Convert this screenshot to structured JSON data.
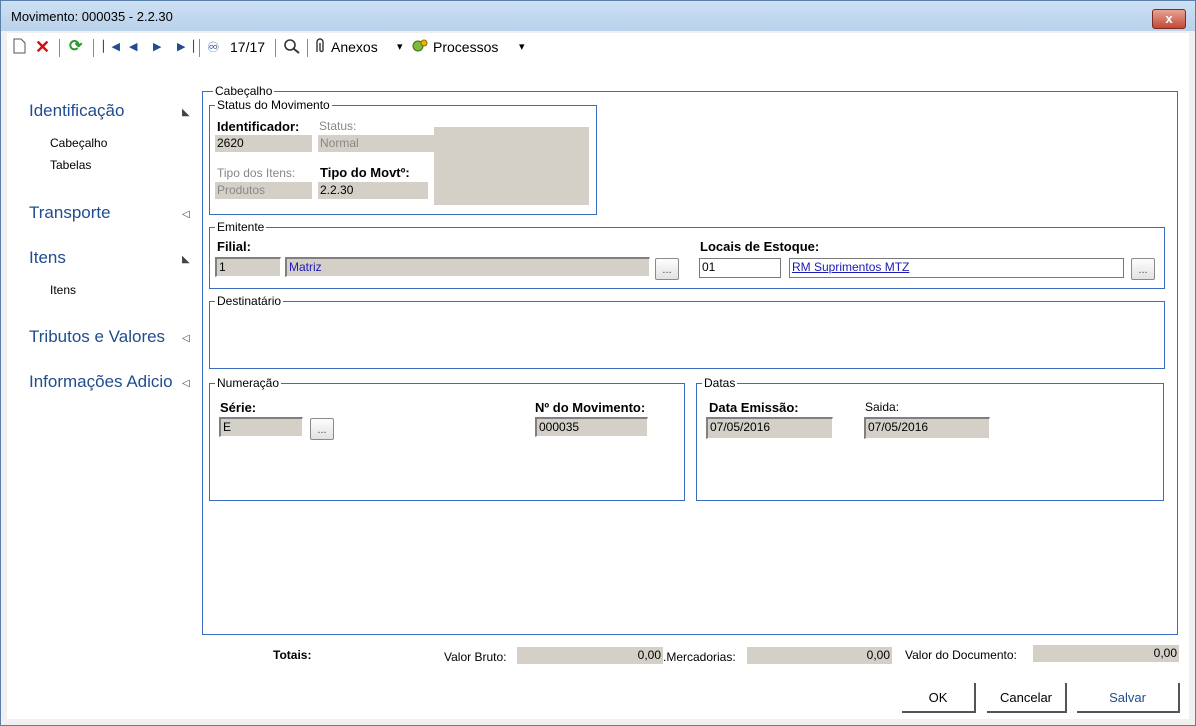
{
  "window": {
    "title": "Movimento: 000035 - 2.2.30",
    "close_label": "x"
  },
  "toolbar": {
    "counter": "17/17",
    "anexos_label": "Anexos",
    "processos_label": "Processos",
    "dropdown_glyph": "▾",
    "icons": [
      "new-icon",
      "delete-icon",
      "refresh-icon",
      "first-icon",
      "prev-icon",
      "next-icon",
      "last-icon",
      "find-icon",
      "zoom-icon",
      "attachment-icon",
      "process-icon"
    ]
  },
  "sidebar": {
    "sections": [
      {
        "label": "Identificação",
        "arrow": "◣",
        "items": [
          "Cabeçalho",
          "Tabelas"
        ]
      },
      {
        "label": "Transporte",
        "arrow": "◁",
        "items": []
      },
      {
        "label": "Itens",
        "arrow": "◣",
        "items": [
          "Itens"
        ]
      },
      {
        "label": "Tributos e Valores",
        "arrow": "◁",
        "items": []
      },
      {
        "label": "Informações Adicio",
        "arrow": "◁",
        "items": []
      }
    ]
  },
  "main": {
    "group_title": "Cabeçalho",
    "status": {
      "title": "Status do Movimento",
      "identificador_label": "Identificador:",
      "identificador_value": "2620",
      "status_label": "Status:",
      "status_value": "Normal",
      "tipo_itens_label": "Tipo dos Itens:",
      "tipo_itens_value": "Produtos",
      "tipo_movto_label": "Tipo do Movtº:",
      "tipo_movto_value": "2.2.30"
    },
    "emitente": {
      "title": "Emitente",
      "filial_label": "Filial:",
      "filial_code": "1",
      "filial_name": "Matriz",
      "locais_label": "Locais de Estoque:",
      "locais_code": "01",
      "locais_name": "RM Suprimentos MTZ",
      "dots": "..."
    },
    "destinatario": {
      "title": "Destinatário"
    },
    "numeracao": {
      "title": "Numeração",
      "serie_label": "Série:",
      "serie_value": "E",
      "num_label": "Nº do Movimento:",
      "num_value": "000035"
    },
    "datas": {
      "title": "Datas",
      "emissao_label": "Data Emissão:",
      "emissao_value": "07/05/2016",
      "saida_label": "Saida:",
      "saida_value": "07/05/2016"
    }
  },
  "totals": {
    "label": "Totais:",
    "valor_bruto_label": "Valor Bruto:",
    "valor_bruto_value": "0,00",
    "mercadorias_label": ".Mercadorias:",
    "mercadorias_value": "0,00",
    "valor_doc_label": "Valor do Documento:",
    "valor_doc_value": "0,00"
  },
  "buttons": {
    "ok": "OK",
    "cancel": "Cancelar",
    "save": "Salvar"
  }
}
